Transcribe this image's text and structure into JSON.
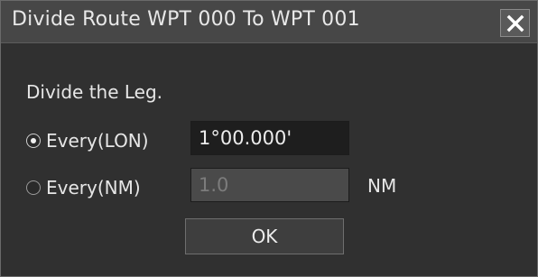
{
  "dialog": {
    "title": "Divide Route WPT 000 To WPT 001",
    "close_icon": "close-icon"
  },
  "form": {
    "heading": "Divide the Leg.",
    "option_lon": {
      "label": "Every(LON)",
      "selected": true,
      "value": "1°00.000'"
    },
    "option_nm": {
      "label": "Every(NM)",
      "selected": false,
      "value": "1.0",
      "unit": "NM"
    },
    "ok_label": "OK"
  }
}
